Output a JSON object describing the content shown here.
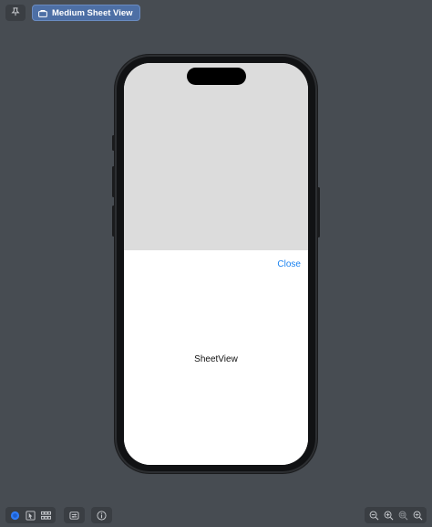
{
  "toolbar": {
    "pin_icon": "pin-icon",
    "preview_label": "Medium Sheet View",
    "preview_icon": "bag-icon"
  },
  "device": {
    "close_label": "Close",
    "sheet_text": "SheetView"
  },
  "bottom_toolbar": {
    "left_icons": [
      "live-preview-icon",
      "selectable-icon",
      "variants-grid-icon"
    ],
    "device_settings_icon": "device-settings-icon",
    "info_icon": "info-icon",
    "zoom_icons": [
      "zoom-out-icon",
      "zoom-in-icon",
      "zoom-fit-icon",
      "zoom-100-icon"
    ]
  },
  "colors": {
    "canvas_bg": "#474c52",
    "accent": "#1a82f0",
    "chip_bg": "#4d6fa5",
    "backdrop": "#dcdcdc"
  }
}
